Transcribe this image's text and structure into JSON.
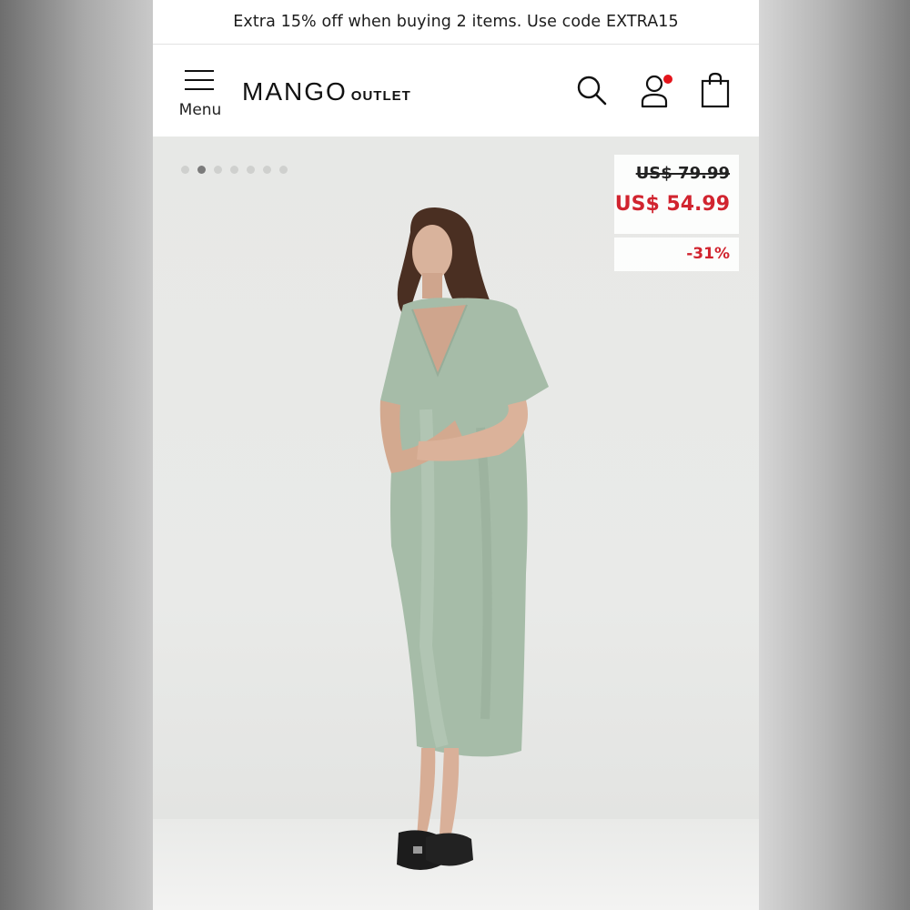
{
  "promo_banner": {
    "text": "Extra 15% off when buying 2 items. Use code EXTRA15"
  },
  "header": {
    "menu_label": "Menu",
    "logo_main": "MANGO",
    "logo_sub": "OUTLET",
    "icons": [
      "search-icon",
      "user-icon",
      "shopping-bag-icon"
    ],
    "notification_color": "#e4141b"
  },
  "gallery": {
    "dot_count": 7,
    "active_dot": 2,
    "product_image": "model wearing sage green satin midi dress"
  },
  "pricing": {
    "original_price": "US$ 79.99",
    "sale_price": "US$ 54.99",
    "discount": "-31%",
    "sale_color": "#d1242f"
  }
}
